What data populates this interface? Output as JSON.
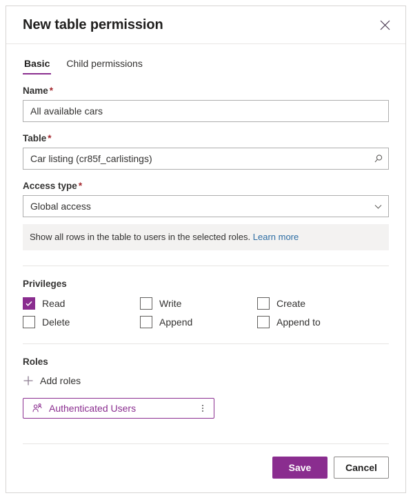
{
  "dialog": {
    "title": "New table permission",
    "close_icon": "close-icon"
  },
  "tabs": [
    {
      "label": "Basic",
      "active": true
    },
    {
      "label": "Child permissions",
      "active": false
    }
  ],
  "form": {
    "name": {
      "label": "Name",
      "required_marker": "*",
      "value": "All available cars",
      "placeholder": ""
    },
    "table": {
      "label": "Table",
      "required_marker": "*",
      "value": "Car listing (cr85f_carlistings)",
      "placeholder": "",
      "icon": "search-icon"
    },
    "access_type": {
      "label": "Access type",
      "required_marker": "*",
      "value": "Global access",
      "icon": "chevron-down-icon",
      "options": [
        "Global access"
      ]
    },
    "info_banner": {
      "text": "Show all rows in the table to users in the selected roles.",
      "link_label": "Learn more"
    }
  },
  "privileges": {
    "title": "Privileges",
    "items": [
      {
        "label": "Read",
        "checked": true
      },
      {
        "label": "Write",
        "checked": false
      },
      {
        "label": "Create",
        "checked": false
      },
      {
        "label": "Delete",
        "checked": false
      },
      {
        "label": "Append",
        "checked": false
      },
      {
        "label": "Append to",
        "checked": false
      }
    ]
  },
  "roles": {
    "title": "Roles",
    "add_label": "Add roles",
    "add_icon": "plus-icon",
    "chips": [
      {
        "label": "Authenticated Users",
        "icon": "contact-icon",
        "menu_icon": "more-vertical-icon"
      }
    ]
  },
  "footer": {
    "save_label": "Save",
    "cancel_label": "Cancel"
  },
  "colors": {
    "accent": "#8a2d8f",
    "required": "#a4262c",
    "link": "#2b6ca3",
    "banner_bg": "#f3f2f1"
  }
}
